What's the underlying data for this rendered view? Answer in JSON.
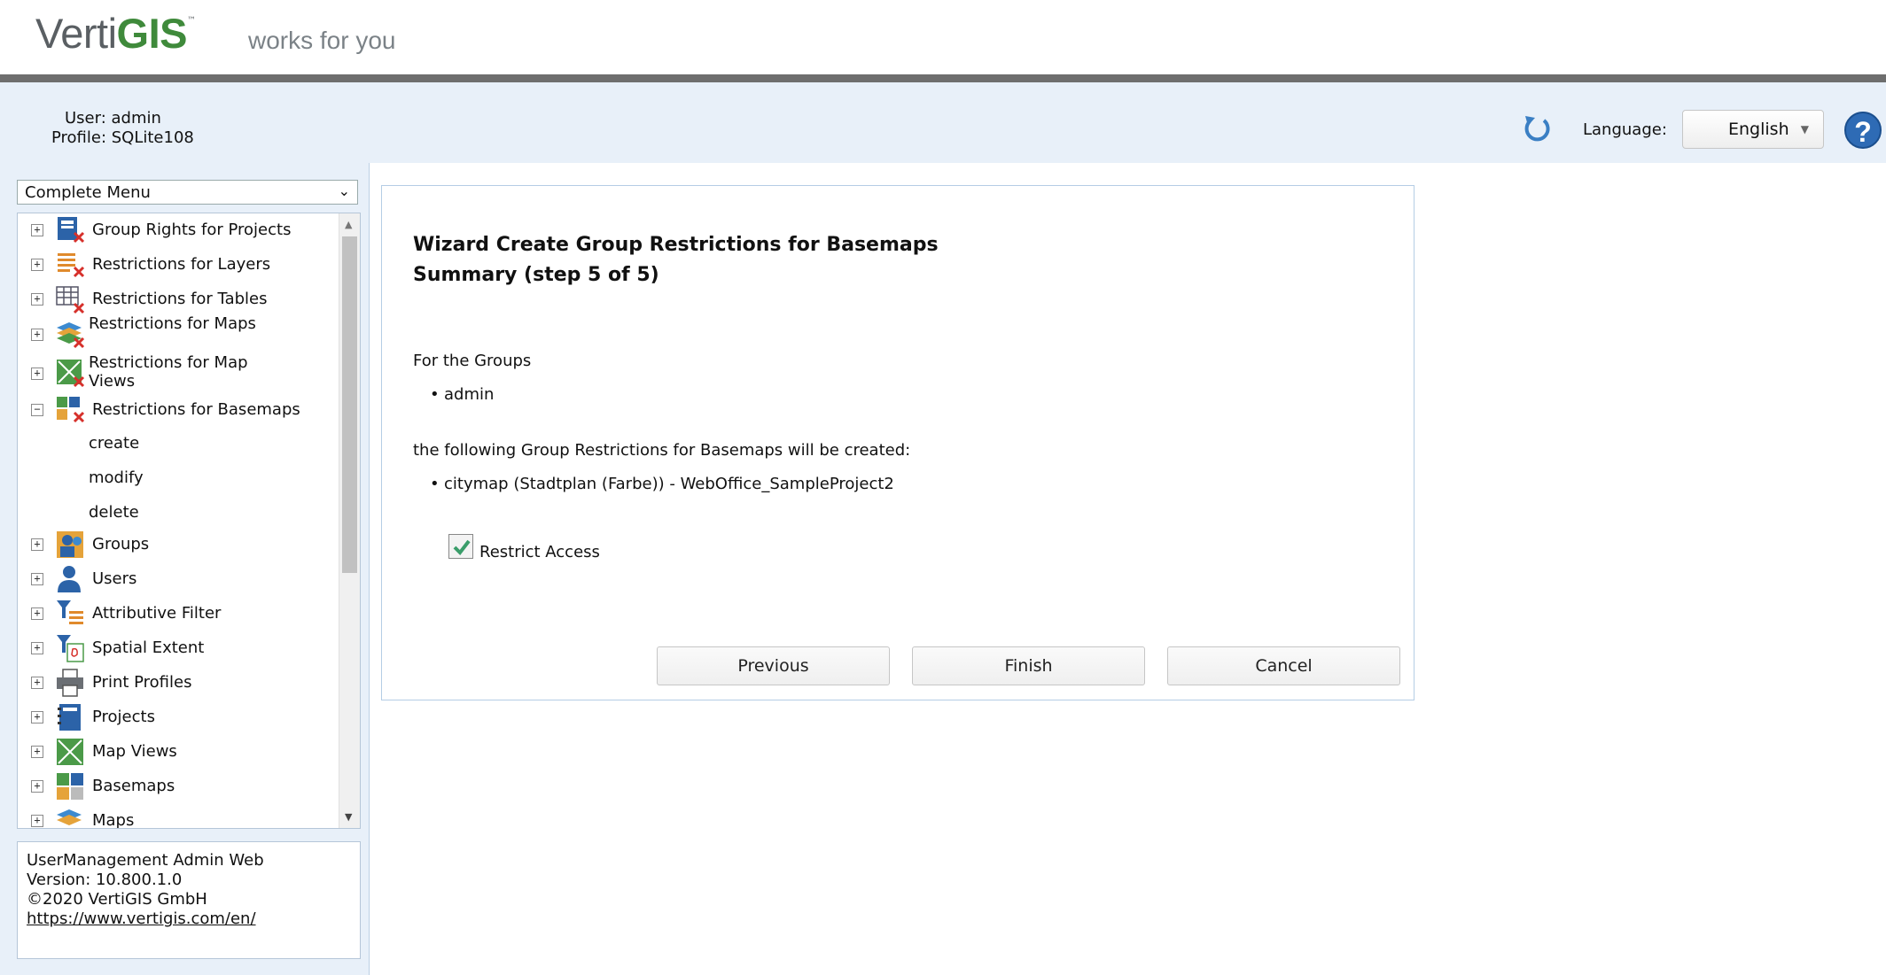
{
  "header": {
    "logo_verti": "Verti",
    "logo_gis": "GIS",
    "logo_tm": "™",
    "tagline": "works for you"
  },
  "userbar": {
    "user_label": "User: admin",
    "profile_label": "Profile: SQLite108",
    "language_label": "Language:",
    "language_value": "English",
    "help_glyph": "?"
  },
  "sidebar": {
    "menu_select": "Complete Menu",
    "items": [
      {
        "label": "Group Rights for Projects",
        "icon": "group-rights-projects-icon",
        "expander": "+"
      },
      {
        "label": "Restrictions for Layers",
        "icon": "layers-restriction-icon",
        "expander": "+"
      },
      {
        "label": "Restrictions for Tables",
        "icon": "tables-restriction-icon",
        "expander": "+"
      },
      {
        "label": "Restrictions for Maps",
        "icon": "maps-restriction-icon",
        "expander": "+"
      },
      {
        "label": "Restrictions for Map Views",
        "icon": "map-views-restriction-icon",
        "expander": "+"
      },
      {
        "label": "Restrictions for Basemaps",
        "icon": "basemaps-restriction-icon",
        "expander": "−"
      },
      {
        "label": "Groups",
        "icon": "groups-icon",
        "expander": "+"
      },
      {
        "label": "Users",
        "icon": "user-icon",
        "expander": "+"
      },
      {
        "label": "Attributive Filter",
        "icon": "filter-icon",
        "expander": "+"
      },
      {
        "label": "Spatial Extent",
        "icon": "spatial-extent-icon",
        "expander": "+"
      },
      {
        "label": "Print Profiles",
        "icon": "printer-icon",
        "expander": "+"
      },
      {
        "label": "Projects",
        "icon": "project-icon",
        "expander": "+"
      },
      {
        "label": "Map Views",
        "icon": "map-views-icon",
        "expander": "+"
      },
      {
        "label": "Basemaps",
        "icon": "basemaps-icon",
        "expander": "+"
      },
      {
        "label": "Maps",
        "icon": "maps-icon",
        "expander": "+"
      }
    ],
    "subitems": [
      "create",
      "modify",
      "delete"
    ]
  },
  "about": {
    "app_name": "UserManagement Admin Web",
    "version": "Version: 10.800.1.0",
    "copyright": "©2020 VertiGIS GmbH",
    "link": "https://www.vertigis.com/en/"
  },
  "wizard": {
    "title_line1": "Wizard Create Group Restrictions for Basemaps",
    "title_line2": "Summary (step 5 of 5)",
    "groups_label": "For the Groups",
    "groups": [
      "admin"
    ],
    "following_label": "the following Group Restrictions for Basemaps will be created:",
    "restrictions": [
      "citymap (Stadtplan (Farbe)) - WebOffice_SampleProject2"
    ],
    "restrict_access_label": "Restrict Access",
    "restrict_access_checked": true,
    "buttons": {
      "previous": "Previous",
      "finish": "Finish",
      "cancel": "Cancel"
    }
  },
  "colors": {
    "accent_green": "#3f8a3b",
    "panel_bg": "#e8f0f9",
    "help_blue": "#2e6bb5"
  }
}
